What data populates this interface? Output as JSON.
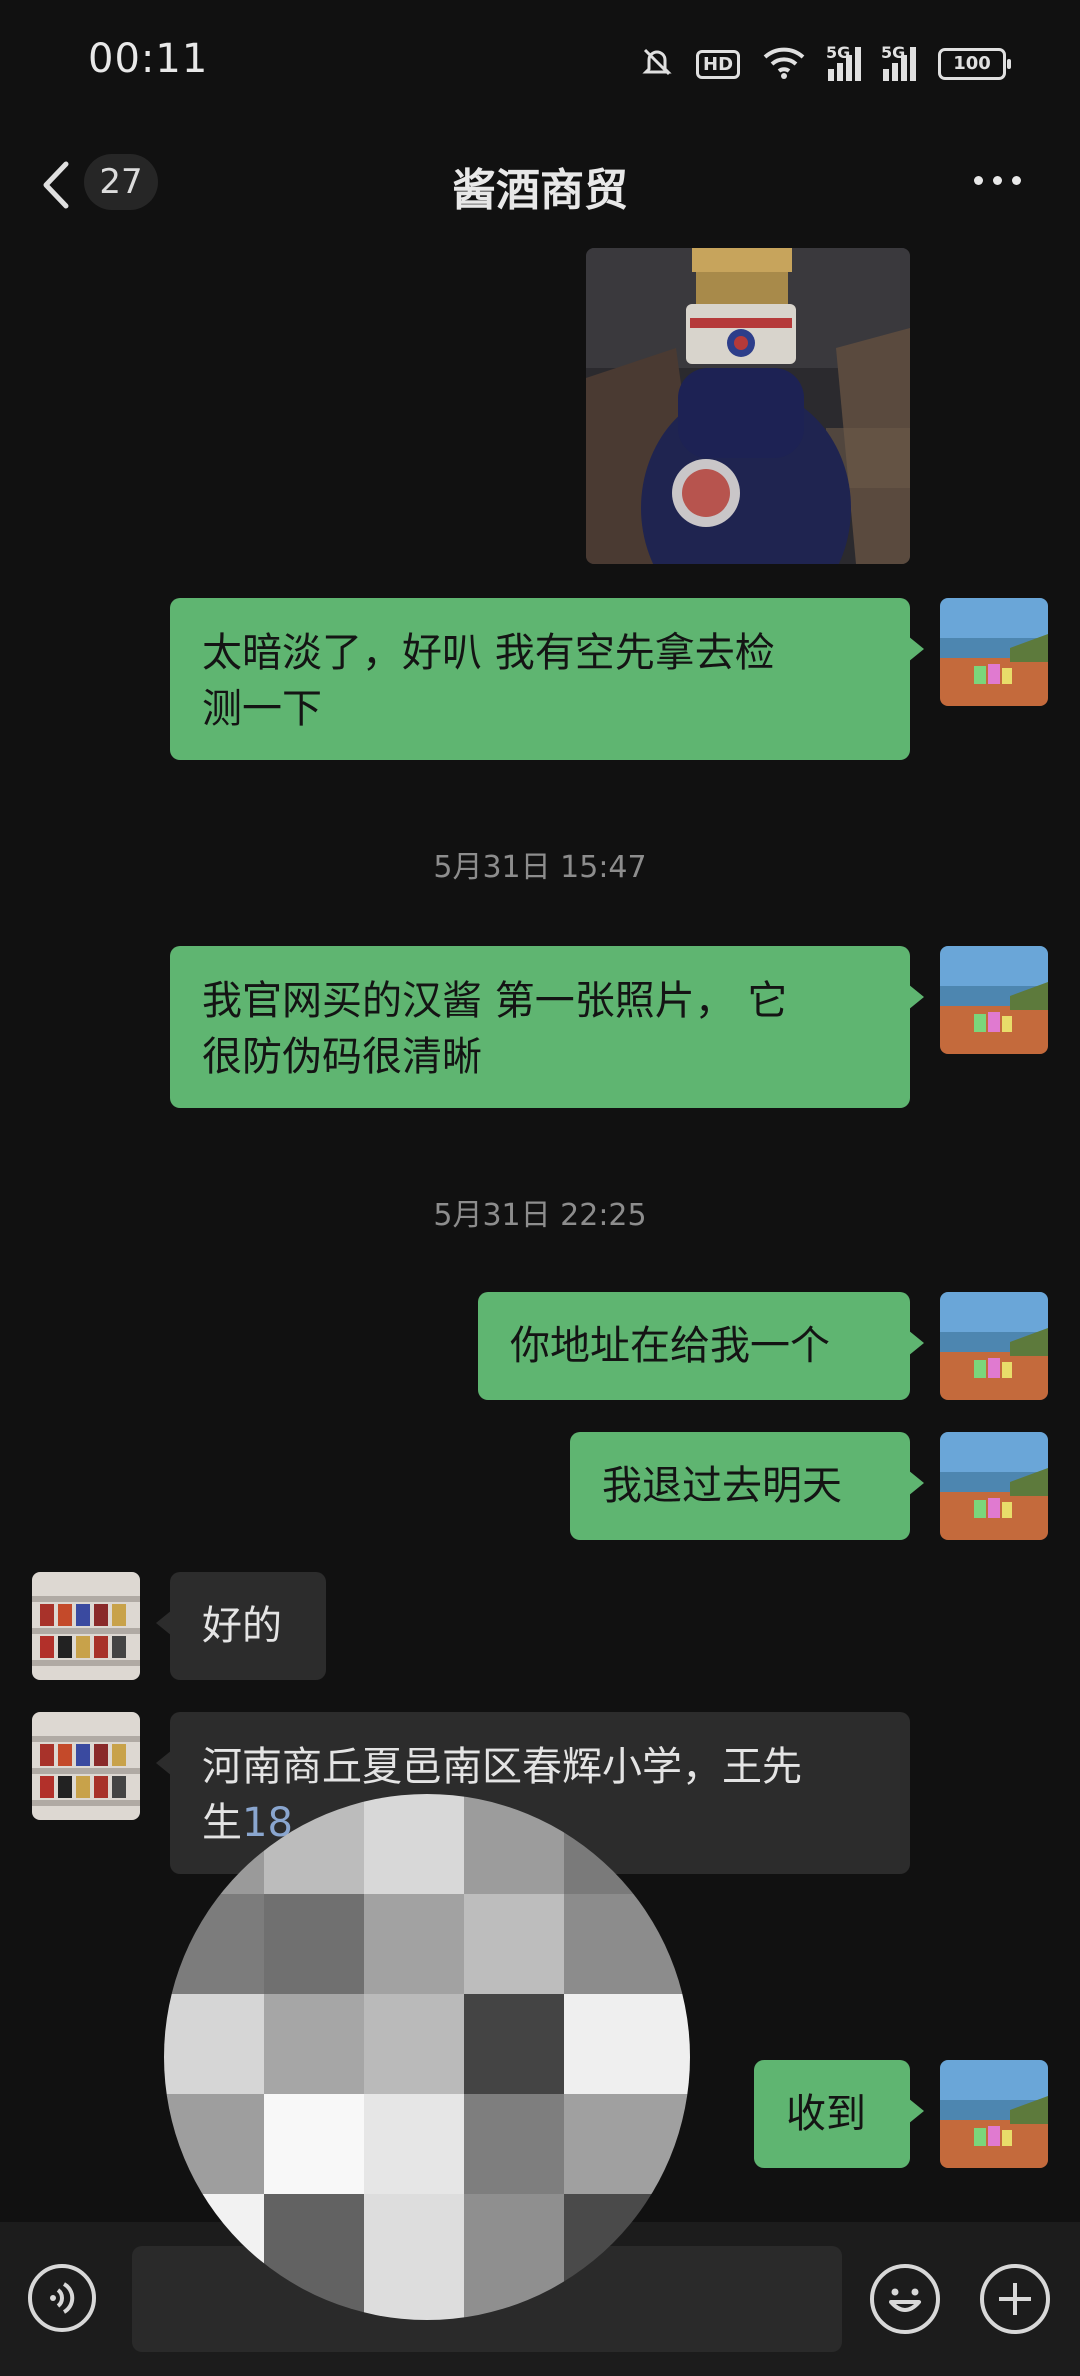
{
  "status_bar": {
    "time": "00:11",
    "battery": "100",
    "hd_badge": "HD",
    "signal_1_label": "5G",
    "signal_2_label": "5G",
    "icons": [
      "mute-bell-icon",
      "hd-icon",
      "wifi-icon",
      "signal-5g-icon",
      "signal-5g-icon",
      "battery-icon"
    ]
  },
  "nav": {
    "back_icon": "chevron-left-icon",
    "unread_count": "27",
    "title": "酱酒商贸",
    "more_icon": "more-dots-icon"
  },
  "messages": [
    {
      "side": "me",
      "type": "image",
      "content": "liquor-bottle-photo"
    },
    {
      "side": "me",
      "type": "text",
      "line1": "太暗淡了，好叭  我有空先拿去检",
      "line2": "测一下"
    },
    {
      "type": "timestamp",
      "text": "5月31日 15:47"
    },
    {
      "side": "me",
      "type": "text",
      "line1": "我官网买的汉酱 第一张照片， 它",
      "line2": "很防伪码很清晰"
    },
    {
      "type": "timestamp",
      "text": "5月31日 22:25"
    },
    {
      "side": "me",
      "type": "text",
      "text": "你地址在给我一个"
    },
    {
      "side": "me",
      "type": "text",
      "text": "我退过去明天"
    },
    {
      "side": "them",
      "type": "text",
      "text": "好的"
    },
    {
      "side": "them",
      "type": "text",
      "line1": "河南商丘夏邑南区春辉小学，王先",
      "line2_prefix": "生",
      "line2_phone": "18"
    },
    {
      "side": "me",
      "type": "text",
      "text": "收到"
    }
  ],
  "input_bar": {
    "voice_icon": "voice-icon",
    "text_value": "",
    "emoji_icon": "emoji-icon",
    "plus_icon": "plus-icon"
  },
  "colors": {
    "background": "#111111",
    "my_bubble": "#5fb571",
    "their_bubble": "#2c2c2c",
    "timestamp": "#8d8d8d"
  }
}
